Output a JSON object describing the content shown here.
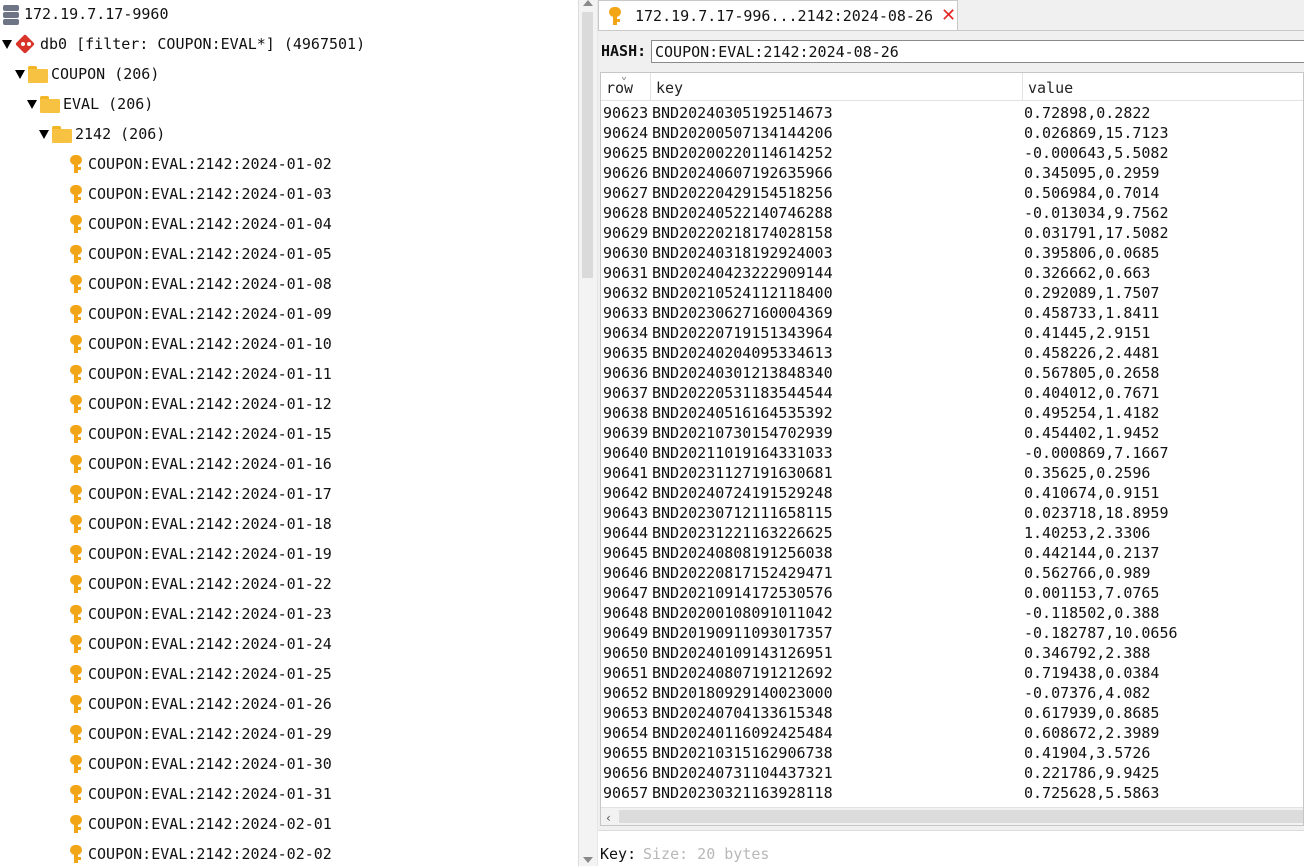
{
  "tree": {
    "server": "172.19.7.17-9960",
    "db": "db0 [filter: COUPON:EVAL*] (4967501)",
    "folders": [
      "COUPON (206)",
      "EVAL (206)",
      "2142 (206)"
    ],
    "keys": [
      "COUPON:EVAL:2142:2024-01-02",
      "COUPON:EVAL:2142:2024-01-03",
      "COUPON:EVAL:2142:2024-01-04",
      "COUPON:EVAL:2142:2024-01-05",
      "COUPON:EVAL:2142:2024-01-08",
      "COUPON:EVAL:2142:2024-01-09",
      "COUPON:EVAL:2142:2024-01-10",
      "COUPON:EVAL:2142:2024-01-11",
      "COUPON:EVAL:2142:2024-01-12",
      "COUPON:EVAL:2142:2024-01-15",
      "COUPON:EVAL:2142:2024-01-16",
      "COUPON:EVAL:2142:2024-01-17",
      "COUPON:EVAL:2142:2024-01-18",
      "COUPON:EVAL:2142:2024-01-19",
      "COUPON:EVAL:2142:2024-01-22",
      "COUPON:EVAL:2142:2024-01-23",
      "COUPON:EVAL:2142:2024-01-24",
      "COUPON:EVAL:2142:2024-01-25",
      "COUPON:EVAL:2142:2024-01-26",
      "COUPON:EVAL:2142:2024-01-29",
      "COUPON:EVAL:2142:2024-01-30",
      "COUPON:EVAL:2142:2024-01-31",
      "COUPON:EVAL:2142:2024-02-01",
      "COUPON:EVAL:2142:2024-02-02"
    ]
  },
  "tab": {
    "title": "172.19.7.17-996...2142:2024-08-26",
    "close": "✕"
  },
  "hash": {
    "label": "HASH:",
    "value": "COUPON:EVAL:2142:2024-08-26"
  },
  "table": {
    "headers": [
      "row",
      "key",
      "value"
    ],
    "rows": [
      [
        "90623",
        "BND20240305192514673",
        "0.72898,0.2822"
      ],
      [
        "90624",
        "BND20200507134144206",
        "0.026869,15.7123"
      ],
      [
        "90625",
        "BND20200220114614252",
        "-0.000643,5.5082"
      ],
      [
        "90626",
        "BND20240607192635966",
        "0.345095,0.2959"
      ],
      [
        "90627",
        "BND20220429154518256",
        "0.506984,0.7014"
      ],
      [
        "90628",
        "BND20240522140746288",
        "-0.013034,9.7562"
      ],
      [
        "90629",
        "BND20220218174028158",
        "0.031791,17.5082"
      ],
      [
        "90630",
        "BND20240318192924003",
        "0.395806,0.0685"
      ],
      [
        "90631",
        "BND20240423222909144",
        "0.326662,0.663"
      ],
      [
        "90632",
        "BND20210524112118400",
        "0.292089,1.7507"
      ],
      [
        "90633",
        "BND20230627160004369",
        "0.458733,1.8411"
      ],
      [
        "90634",
        "BND20220719151343964",
        "0.41445,2.9151"
      ],
      [
        "90635",
        "BND20240204095334613",
        "0.458226,2.4481"
      ],
      [
        "90636",
        "BND20240301213848340",
        "0.567805,0.2658"
      ],
      [
        "90637",
        "BND20220531183544544",
        "0.404012,0.7671"
      ],
      [
        "90638",
        "BND20240516164535392",
        "0.495254,1.4182"
      ],
      [
        "90639",
        "BND20210730154702939",
        "0.454402,1.9452"
      ],
      [
        "90640",
        "BND20211019164331033",
        "-0.000869,7.1667"
      ],
      [
        "90641",
        "BND20231127191630681",
        "0.35625,0.2596"
      ],
      [
        "90642",
        "BND20240724191529248",
        "0.410674,0.9151"
      ],
      [
        "90643",
        "BND20230712111658115",
        "0.023718,18.8959"
      ],
      [
        "90644",
        "BND20231221163226625",
        "1.40253,2.3306"
      ],
      [
        "90645",
        "BND20240808191256038",
        "0.442144,0.2137"
      ],
      [
        "90646",
        "BND20220817152429471",
        "0.562766,0.989"
      ],
      [
        "90647",
        "BND20210914172530576",
        "0.001153,7.0765"
      ],
      [
        "90648",
        "BND20200108091011042",
        "-0.118502,0.388"
      ],
      [
        "90649",
        "BND20190911093017357",
        "-0.182787,10.0656"
      ],
      [
        "90650",
        "BND20240109143126951",
        "0.346792,2.388"
      ],
      [
        "90651",
        "BND20240807191212692",
        "0.719438,0.0384"
      ],
      [
        "90652",
        "BND20180929140023000",
        "-0.07376,4.082"
      ],
      [
        "90653",
        "BND20240704133615348",
        "0.617939,0.8685"
      ],
      [
        "90654",
        "BND20240116092425484",
        "0.608672,2.3989"
      ],
      [
        "90655",
        "BND20210315162906738",
        "0.41904,3.5726"
      ],
      [
        "90656",
        "BND20240731104437321",
        "0.221786,9.9425"
      ],
      [
        "90657",
        "BND20230321163928118",
        "0.725628,5.5863"
      ]
    ]
  },
  "status": {
    "label": "Key:",
    "value": "Size: 20 bytes"
  },
  "icons": {
    "server": "server-icon",
    "db": "redis-db-icon",
    "folder": "folder-icon",
    "key": "key-icon",
    "close": "close-icon"
  },
  "colors": {
    "key_icon": "#f2a516",
    "folder_icon": "#f7c242",
    "db_icon": "#d8342a",
    "close": "#e22828"
  }
}
